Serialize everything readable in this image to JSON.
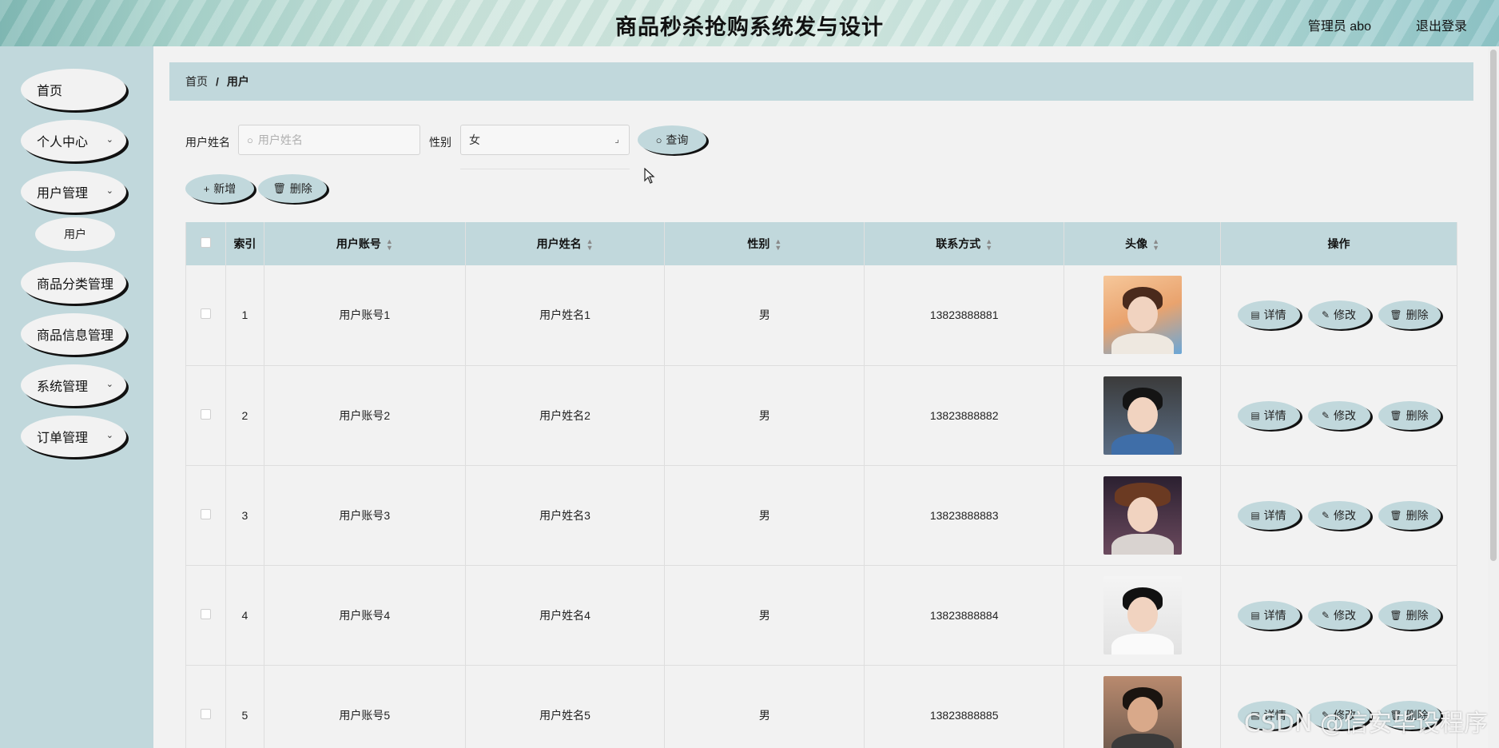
{
  "header": {
    "title": "商品秒杀抢购系统发与设计",
    "user_label": "管理员 abo",
    "logout_label": "退出登录"
  },
  "sidebar": {
    "items": [
      {
        "label": "首页",
        "has_chevron": false
      },
      {
        "label": "个人中心",
        "has_chevron": true
      },
      {
        "label": "用户管理",
        "has_chevron": true
      },
      {
        "label": "商品分类管理",
        "has_chevron": false
      },
      {
        "label": "商品信息管理",
        "has_chevron": false
      },
      {
        "label": "系统管理",
        "has_chevron": true
      },
      {
        "label": "订单管理",
        "has_chevron": true
      }
    ],
    "submenu_label": "用户",
    "chevron": "⌄"
  },
  "breadcrumb": {
    "home": "首页",
    "separator": "/",
    "current": "用户"
  },
  "search": {
    "name_label": "用户姓名",
    "name_placeholder": "用户姓名",
    "gender_label": "性别",
    "gender_value": "女",
    "query_label": "查询"
  },
  "actions": {
    "add_label": "新增",
    "delete_label": "删除"
  },
  "table": {
    "headers": [
      "索引",
      "用户账号",
      "用户姓名",
      "性别",
      "联系方式",
      "头像",
      "操作"
    ],
    "rows": [
      {
        "index": "1",
        "account": "用户账号1",
        "name": "用户姓名1",
        "gender": "男",
        "phone": "13823888881"
      },
      {
        "index": "2",
        "account": "用户账号2",
        "name": "用户姓名2",
        "gender": "男",
        "phone": "13823888882"
      },
      {
        "index": "3",
        "account": "用户账号3",
        "name": "用户姓名3",
        "gender": "男",
        "phone": "13823888883"
      },
      {
        "index": "4",
        "account": "用户账号4",
        "name": "用户姓名4",
        "gender": "男",
        "phone": "13823888884"
      },
      {
        "index": "5",
        "account": "用户账号5",
        "name": "用户姓名5",
        "gender": "男",
        "phone": "13823888885"
      }
    ],
    "op_detail": "详情",
    "op_edit": "修改",
    "op_delete": "删除"
  },
  "colors": {
    "accent": "#c1d8dc",
    "background": "#f2f2f2"
  },
  "watermark": "CSDN @信安毕设程序"
}
